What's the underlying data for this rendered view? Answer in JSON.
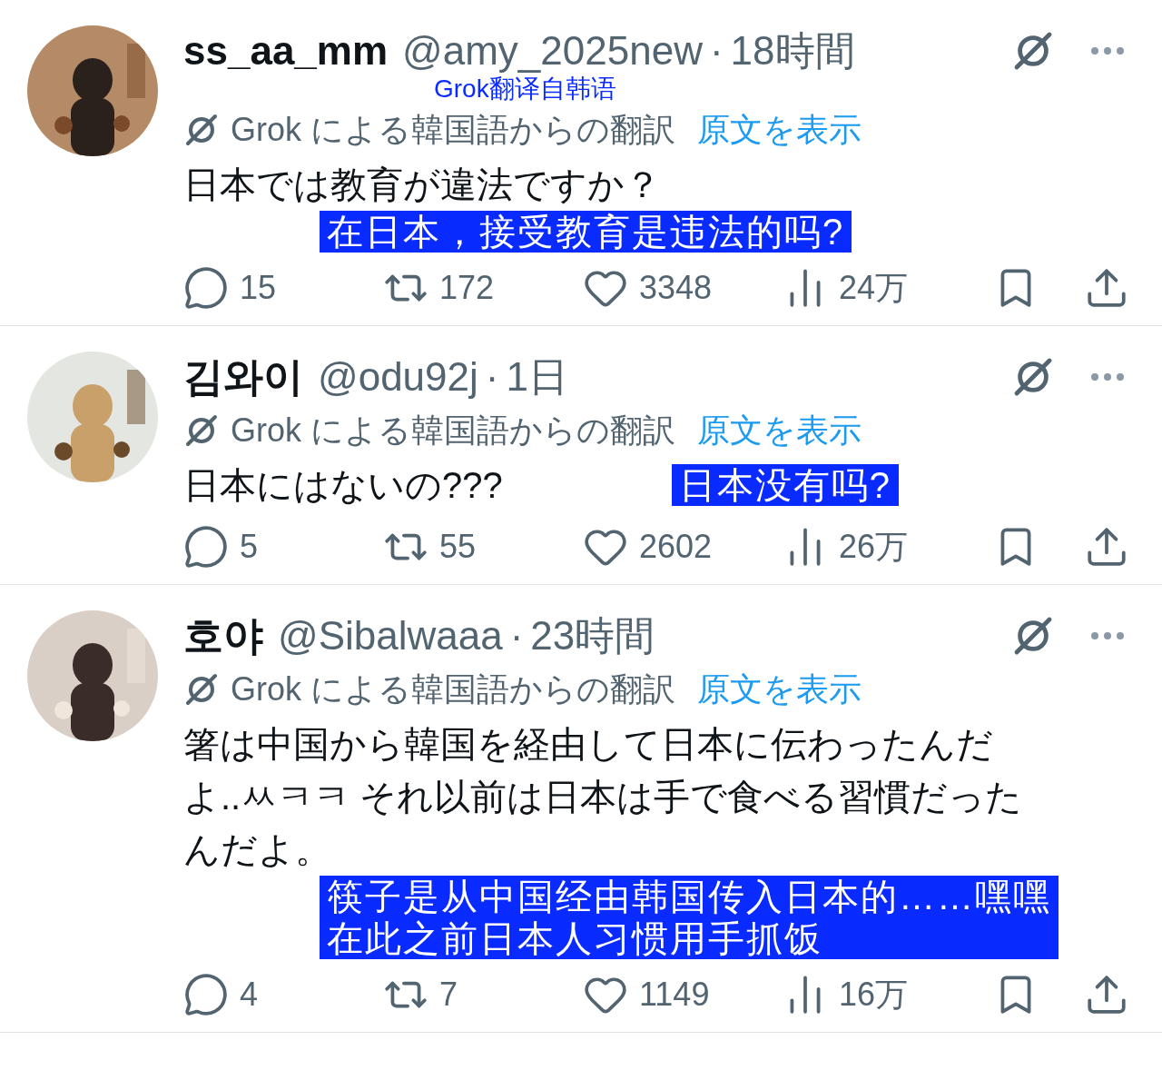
{
  "tweets": [
    {
      "name": "ss_aa_mm",
      "handle": "@amy_2025new",
      "separator": "·",
      "time": "18時間",
      "overlay_note": "Grok翻译自韩语",
      "translated_label": "Grok による韓国語からの翻訳",
      "show_original": "原文を表示",
      "body": [
        "日本では教育が違法ですか？"
      ],
      "overlay": [
        "在日本，接受教育是违法的吗?"
      ],
      "stats": {
        "replies": "15",
        "reposts": "172",
        "likes": "3348",
        "views": "24万"
      }
    },
    {
      "name": "김와이",
      "handle": "@odu92j",
      "separator": "·",
      "time": "1日",
      "translated_label": "Grok による韓国語からの翻訳",
      "show_original": "原文を表示",
      "body": [
        "日本にはないの???"
      ],
      "overlay": [
        "日本没有吗?"
      ],
      "stats": {
        "replies": "5",
        "reposts": "55",
        "likes": "2602",
        "views": "26万"
      }
    },
    {
      "name": "호야",
      "handle": "@Sibalwaaa",
      "separator": "·",
      "time": "23時間",
      "translated_label": "Grok による韓国語からの翻訳",
      "show_original": "原文を表示",
      "body": [
        "箸は中国から韓国を経由して日本に伝わったんだ",
        "よ..ㅆㅋㅋ それ以前は日本は手で食べる習慣だった",
        "んだよ。"
      ],
      "overlay": [
        "筷子是从中国经由韩国传入日本的……嘿嘿",
        "在此之前日本人习惯用手抓饭"
      ],
      "stats": {
        "replies": "4",
        "reposts": "7",
        "likes": "1149",
        "views": "16万"
      }
    }
  ]
}
